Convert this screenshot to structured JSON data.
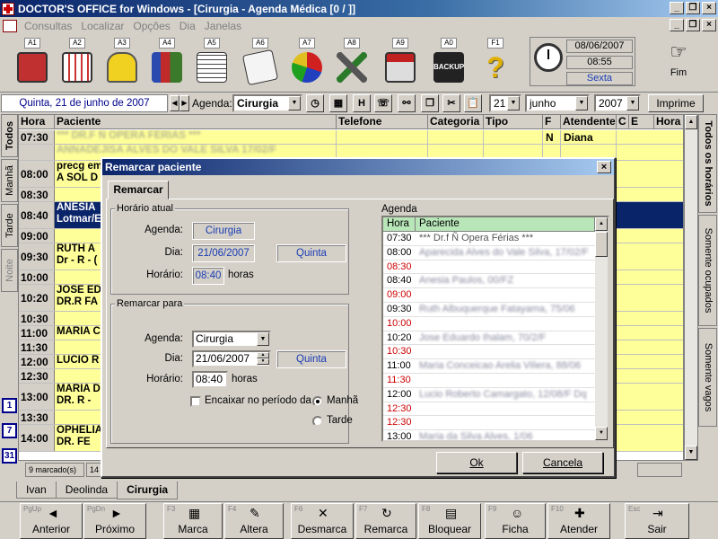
{
  "window": {
    "title": "DOCTOR'S OFFICE for Windows - [Cirurgia - Agenda Médica [0 / ]]",
    "minimize": "_",
    "restore": "❐",
    "close": "×"
  },
  "menu": [
    "Consultas",
    "Localizar",
    "Opções",
    "Dia",
    "Janelas"
  ],
  "toolbar": {
    "keys": [
      "A1",
      "A2",
      "A3",
      "A4",
      "A5",
      "A6",
      "A7",
      "A8",
      "A9",
      "A0",
      "F1"
    ],
    "backup_label": "BACKUP",
    "clock_date": "08/06/2007",
    "clock_time": "08:55",
    "clock_day": "Sexta",
    "fim_label": "Fim"
  },
  "nav": {
    "date_label": "Quinta, 21 de junho de 2007",
    "prev": "◀",
    "next": "▶",
    "agenda_label": "Agenda:",
    "agenda_value": "Cirurgia",
    "h_button": "H",
    "day_value": "21",
    "month_value": "junho",
    "year_value": "2007",
    "print_label": "Imprime"
  },
  "left_tabs": [
    "Todos",
    "Manhã",
    "Tarde",
    "Noite"
  ],
  "cal_buttons": [
    "1",
    "7",
    "31"
  ],
  "right_tabs": [
    "Todos os horários",
    "Somente ocupados",
    "Somente vagos"
  ],
  "grid": {
    "headers": [
      "Hora",
      "Paciente",
      "Telefone",
      "Categoria",
      "Tipo",
      "F",
      "Atendente",
      "C",
      "E",
      "Hora"
    ],
    "rows": [
      {
        "hora": "07:30",
        "line1": "*** DR.F Ñ OPERA FÉRIAS ***",
        "line2": "",
        "blur1": true,
        "f": "N",
        "atendente": "Diana"
      },
      {
        "hora": "",
        "line1": "ANNADEJISA ALVES DO VALE SILVA 17/02/F",
        "line2": "",
        "blur1": true,
        "f": "",
        "atendente": ""
      },
      {
        "hora": "08:00",
        "line1": "precg em",
        "line2": "A SOL D",
        "blur1": false,
        "f": "",
        "atendente": ""
      },
      {
        "hora": "08:30",
        "line1": "",
        "line2": "",
        "blur1": false,
        "f": "",
        "atendente": ""
      },
      {
        "hora": "08:40",
        "line1": "ANESIA",
        "line2": "Lotmar/E",
        "blur1": false,
        "f": "",
        "atendente": ""
      },
      {
        "hora": "09:00",
        "line1": "",
        "line2": "",
        "blur1": false,
        "f": "",
        "atendente": ""
      },
      {
        "hora": "09:30",
        "line1": "RUTH A",
        "line2": "Dr - R - (",
        "blur1": false,
        "f": "",
        "atendente": ""
      },
      {
        "hora": "10:00",
        "line1": "",
        "line2": "",
        "blur1": false,
        "f": "",
        "atendente": ""
      },
      {
        "hora": "10:20",
        "line1": "JOSE ED",
        "line2": "DR.R FA",
        "blur1": false,
        "f": "",
        "atendente": ""
      },
      {
        "hora": "10:30",
        "line1": "",
        "line2": "",
        "blur1": false,
        "f": "",
        "atendente": ""
      },
      {
        "hora": "11:00",
        "line1": "MARIA C",
        "line2": "",
        "blur1": false,
        "f": "",
        "atendente": ""
      },
      {
        "hora": "11:30",
        "line1": "",
        "line2": "",
        "blur1": false,
        "f": "",
        "atendente": ""
      },
      {
        "hora": "12:00",
        "line1": "LUCIO R",
        "line2": "",
        "blur1": false,
        "f": "",
        "atendente": ""
      },
      {
        "hora": "12:30",
        "line1": "",
        "line2": "",
        "blur1": false,
        "f": "",
        "atendente": ""
      },
      {
        "hora": "13:00",
        "line1": "MARIA D",
        "line2": "DR. R - ",
        "blur1": false,
        "f": "",
        "atendente": ""
      },
      {
        "hora": "13:30",
        "line1": "",
        "line2": "",
        "blur1": false,
        "f": "",
        "atendente": ""
      },
      {
        "hora": "14:00",
        "line1": "OPHELIA",
        "line2": "DR. FE",
        "blur1": false,
        "f": "",
        "atendente": ""
      }
    ]
  },
  "status": {
    "marked": "9 marcado(s)",
    "cell2": "14"
  },
  "bottom_tabs": [
    "Ivan",
    "Deolinda",
    "Cirurgia"
  ],
  "fbar": [
    {
      "key": "PgUp",
      "label": "Anterior",
      "icon": "◄"
    },
    {
      "key": "PgDn",
      "label": "Próximo",
      "icon": "►"
    },
    {
      "key": "F3",
      "label": "Marca",
      "icon": "▦"
    },
    {
      "key": "F4",
      "label": "Altera",
      "icon": "✎"
    },
    {
      "key": "F6",
      "label": "Desmarca",
      "icon": "✕"
    },
    {
      "key": "F7",
      "label": "Remarca",
      "icon": "↻"
    },
    {
      "key": "F8",
      "label": "Bloquear",
      "icon": "▤"
    },
    {
      "key": "F9",
      "label": "Ficha",
      "icon": "☺"
    },
    {
      "key": "F10",
      "label": "Atender",
      "icon": "✚"
    },
    {
      "key": "Esc",
      "label": "Sair",
      "icon": "⇥"
    }
  ],
  "dialog": {
    "title": "Remarcar paciente",
    "close": "×",
    "tab": "Remarcar",
    "current": {
      "group": "Horário atual",
      "agenda_lbl": "Agenda:",
      "agenda": "Cirurgia",
      "dia_lbl": "Dia:",
      "dia": "21/06/2007",
      "weekday": "Quinta",
      "horario_lbl": "Horário:",
      "horario": "08:40",
      "horas": "horas"
    },
    "new": {
      "group": "Remarcar para",
      "agenda_lbl": "Agenda:",
      "agenda": "Cirurgia",
      "dia_lbl": "Dia:",
      "dia": "21/06/2007",
      "weekday": "Quinta",
      "horario_lbl": "Horário:",
      "horario": "08:40",
      "horas": "horas",
      "encaixar": "Encaixar no período da",
      "manha": "Manhã",
      "tarde": "Tarde"
    },
    "agenda": {
      "group": "Agenda",
      "col_hora": "Hora",
      "col_paciente": "Paciente",
      "rows": [
        {
          "hora": "07:30",
          "paciente": "*** Dr.f Ñ Opera  Férias ***",
          "red": false,
          "blur": false
        },
        {
          "hora": "08:00",
          "paciente": "Aparecida Alves do Vale Silva, 17/02/F",
          "red": false,
          "blur": true
        },
        {
          "hora": "08:30",
          "paciente": "",
          "red": true,
          "blur": false
        },
        {
          "hora": "08:40",
          "paciente": "Anesia Paulos, 00/FZ",
          "red": false,
          "blur": true
        },
        {
          "hora": "09:00",
          "paciente": "",
          "red": true,
          "blur": false
        },
        {
          "hora": "09:30",
          "paciente": "Ruth Albuquerque Fatayama, 75/06",
          "red": false,
          "blur": true
        },
        {
          "hora": "10:00",
          "paciente": "",
          "red": true,
          "blur": false
        },
        {
          "hora": "10:20",
          "paciente": "Jose Eduardo Ihalam, 70/2/F",
          "red": false,
          "blur": true
        },
        {
          "hora": "10:30",
          "paciente": "",
          "red": true,
          "blur": false
        },
        {
          "hora": "11:00",
          "paciente": "Maria Conceicao Arelia Viliera, 88/06",
          "red": false,
          "blur": true
        },
        {
          "hora": "11:30",
          "paciente": "",
          "red": true,
          "blur": false
        },
        {
          "hora": "12:00",
          "paciente": "Lucio Roberto Camargato, 12/08/F Dq",
          "red": false,
          "blur": true
        },
        {
          "hora": "12:30",
          "paciente": "",
          "red": true,
          "blur": false
        },
        {
          "hora": "12:30",
          "paciente": "",
          "red": true,
          "blur": false
        },
        {
          "hora": "13:00",
          "paciente": "Maria da Silva Alves, 1/06",
          "red": false,
          "blur": true
        }
      ]
    },
    "ok": "Ok",
    "cancel": "Cancela"
  },
  "colors": {
    "schedule_bg": "#ffff99",
    "selected_row": "#0a246a",
    "title_blue": "#0a246a",
    "agenda_header": "#b8e6b8"
  }
}
